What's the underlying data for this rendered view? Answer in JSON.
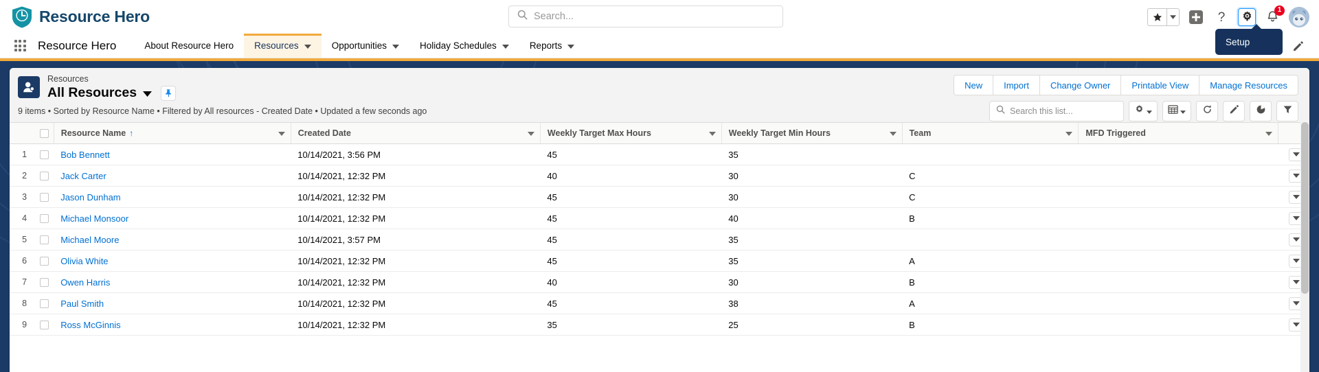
{
  "header": {
    "brand_name": "Resource Hero",
    "logo_icon": "shield-clock-icon",
    "search_placeholder": "Search...",
    "search_icon": "search-icon",
    "favorites_icon": "star-icon",
    "favorites_caret_icon": "chevron-down-icon",
    "add_icon": "plus-icon",
    "help_icon": "question-mark-icon",
    "setup_icon": "gear-icon",
    "notifications_icon": "bell-icon",
    "notifications_count": "1",
    "avatar_icon": "user-avatar",
    "tooltip_text": "Setup"
  },
  "app_nav": {
    "waffle_icon": "app-launcher-icon",
    "app_name": "Resource Hero",
    "edit_icon": "pencil-icon",
    "items": [
      {
        "label": "About Resource Hero",
        "has_caret": false,
        "active": false
      },
      {
        "label": "Resources",
        "has_caret": true,
        "active": true
      },
      {
        "label": "Opportunities",
        "has_caret": true,
        "active": false
      },
      {
        "label": "Holiday Schedules",
        "has_caret": true,
        "active": false
      },
      {
        "label": "Reports",
        "has_caret": true,
        "active": false
      }
    ]
  },
  "list_view": {
    "object_icon": "user-object-icon",
    "object_label": "Resources",
    "title": "All Resources",
    "title_caret_icon": "chevron-down-icon",
    "pin_icon": "pin-icon",
    "meta": "9 items • Sorted by Resource Name • Filtered by All resources - Created Date • Updated a few seconds ago",
    "buttons": [
      "New",
      "Import",
      "Change Owner",
      "Printable View",
      "Manage Resources"
    ],
    "search_placeholder": "Search this list...",
    "search_icon": "search-icon",
    "tools": [
      {
        "name": "list-view-controls-button",
        "icon": "gear-icon",
        "caret": true
      },
      {
        "name": "display-as-button",
        "icon": "table-icon",
        "caret": true
      },
      {
        "name": "refresh-button",
        "icon": "refresh-icon",
        "caret": false
      },
      {
        "name": "edit-button",
        "icon": "pencil-icon",
        "caret": false
      },
      {
        "name": "charts-button",
        "icon": "chart-icon",
        "caret": false
      },
      {
        "name": "filter-button",
        "icon": "filter-icon",
        "caret": false
      }
    ]
  },
  "table": {
    "select_all_icon": "checkbox-icon",
    "sort_arrow": "↑",
    "columns": [
      {
        "label": "Resource Name",
        "sorted": true
      },
      {
        "label": "Created Date",
        "sorted": false
      },
      {
        "label": "Weekly Target Max Hours",
        "sorted": false
      },
      {
        "label": "Weekly Target Min Hours",
        "sorted": false
      },
      {
        "label": "Team",
        "sorted": false
      },
      {
        "label": "MFD Triggered",
        "sorted": false
      }
    ],
    "rows": [
      {
        "num": "1",
        "name": "Bob Bennett",
        "created": "10/14/2021, 3:56 PM",
        "max": "45",
        "min": "35",
        "team": "",
        "mfd": ""
      },
      {
        "num": "2",
        "name": "Jack Carter",
        "created": "10/14/2021, 12:32 PM",
        "max": "40",
        "min": "30",
        "team": "C",
        "mfd": ""
      },
      {
        "num": "3",
        "name": "Jason Dunham",
        "created": "10/14/2021, 12:32 PM",
        "max": "45",
        "min": "30",
        "team": "C",
        "mfd": ""
      },
      {
        "num": "4",
        "name": "Michael Monsoor",
        "created": "10/14/2021, 12:32 PM",
        "max": "45",
        "min": "40",
        "team": "B",
        "mfd": ""
      },
      {
        "num": "5",
        "name": "Michael Moore",
        "created": "10/14/2021, 3:57 PM",
        "max": "45",
        "min": "35",
        "team": "",
        "mfd": ""
      },
      {
        "num": "6",
        "name": "Olivia White",
        "created": "10/14/2021, 12:32 PM",
        "max": "45",
        "min": "35",
        "team": "A",
        "mfd": ""
      },
      {
        "num": "7",
        "name": "Owen Harris",
        "created": "10/14/2021, 12:32 PM",
        "max": "40",
        "min": "30",
        "team": "B",
        "mfd": ""
      },
      {
        "num": "8",
        "name": "Paul Smith",
        "created": "10/14/2021, 12:32 PM",
        "max": "45",
        "min": "38",
        "team": "A",
        "mfd": ""
      },
      {
        "num": "9",
        "name": "Ross McGinnis",
        "created": "10/14/2021, 12:32 PM",
        "max": "35",
        "min": "25",
        "team": "B",
        "mfd": ""
      }
    ],
    "row_action_icon": "chevron-down-icon"
  },
  "colors": {
    "brand_navy": "#16476b",
    "accent_orange": "#f2a93b",
    "link_blue": "#0070d2",
    "page_bg": "#1b3a66",
    "badge_red": "#ea001e"
  }
}
